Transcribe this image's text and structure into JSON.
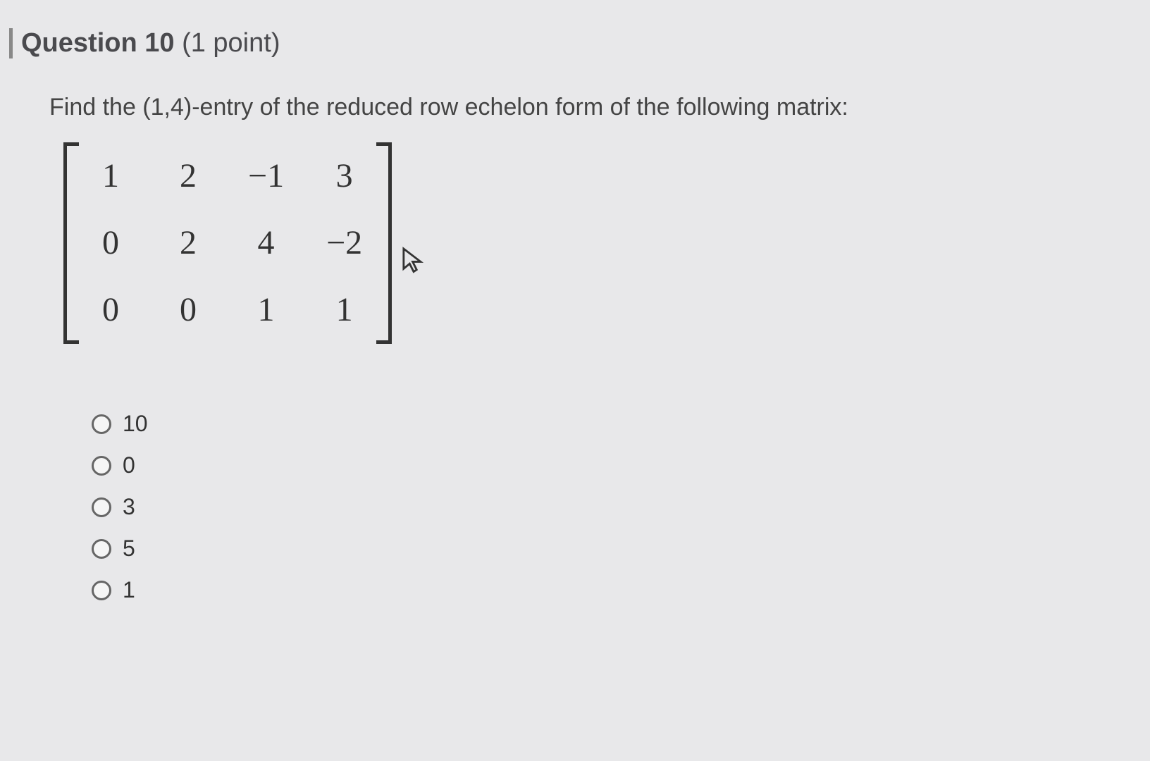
{
  "question": {
    "header_prefix": "Question ",
    "number": "10",
    "points_text": " (1 point)",
    "prompt": "Find the (1,4)-entry of the reduced row echelon form of the following matrix:"
  },
  "matrix": {
    "rows": [
      [
        "1",
        "2",
        "−1",
        "3"
      ],
      [
        "0",
        "2",
        "4",
        "−2"
      ],
      [
        "0",
        "0",
        "1",
        "1"
      ]
    ]
  },
  "options": [
    "10",
    "0",
    "3",
    "5",
    "1"
  ]
}
